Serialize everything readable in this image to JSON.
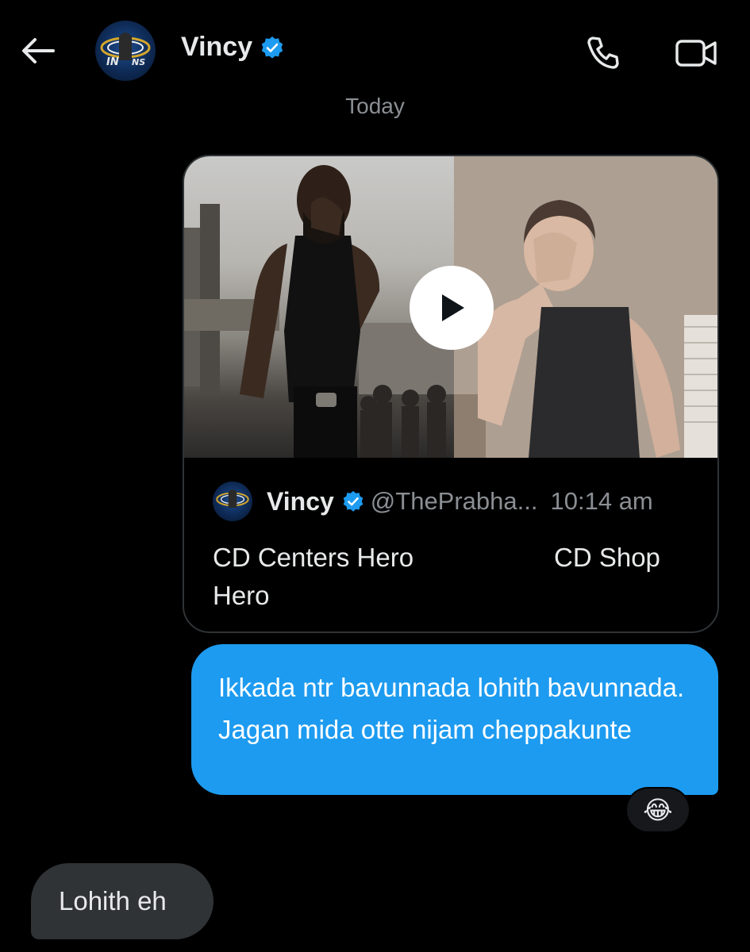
{
  "header": {
    "contact_name": "Vincy",
    "back_icon": "arrow-left-icon",
    "call_icon": "phone-icon",
    "video_icon": "video-camera-icon",
    "verified_color": "#1d9bf0"
  },
  "date_separator": "Today",
  "shared_post": {
    "author_name": "Vincy",
    "author_handle": "@TheP rabha...",
    "time": "10:14 am",
    "text_left": "CD Centers Hero Hero",
    "text_right": "CD Shop",
    "play_icon": "play-icon"
  },
  "messages": {
    "outgoing_text": "Ikkada ntr bavunnada lohith bavunnada. Jagan mida otte nijam cheppakunte",
    "outgoing_reaction": "😂",
    "incoming_text": "Lohith eh"
  },
  "colors": {
    "background": "#000000",
    "outgoing_bubble": "#1d9bf0",
    "incoming_bubble": "#2f3336",
    "muted_text": "#8b8f94"
  }
}
